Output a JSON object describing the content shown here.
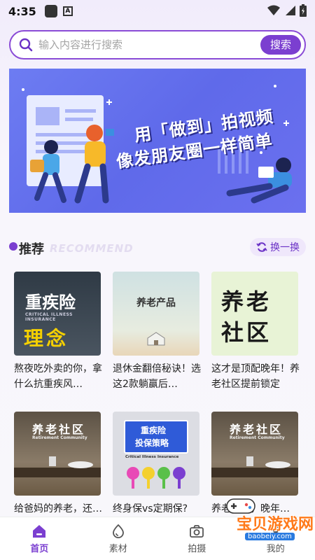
{
  "status_bar": {
    "time": "4:35",
    "icons": [
      "app-square-icon",
      "a-badge-icon",
      "wifi-icon",
      "signal-icon",
      "battery-icon"
    ]
  },
  "search": {
    "placeholder": "输入内容进行搜索",
    "value": "",
    "button_label": "搜索"
  },
  "banner": {
    "line1": "用「做到」拍视频",
    "line2": "像发朋友圈一样简单"
  },
  "recommend": {
    "title": "推荐",
    "title_en": "RECOMMEND",
    "swap_label": "换一换"
  },
  "cards": [
    {
      "caption": "熬夜吃外卖的你，拿什么抗重疾风…",
      "thumb_line1": "重疾险",
      "thumb_line2": "理念",
      "thumb_sub": "CRITICAL ILLNESS INSURANCE"
    },
    {
      "caption": "退休金翻倍秘诀！选这2款躺赢后…",
      "thumb_line1": "养老产品"
    },
    {
      "caption": "这才是顶配晚年！养老社区提前锁定",
      "thumb_line1": "养老",
      "thumb_line2": "社区"
    },
    {
      "caption": "给爸妈的养老，还…",
      "thumb_line1": "养老社区",
      "thumb_sub": "Retirement Community"
    },
    {
      "caption": "终身保vs定期保?",
      "thumb_line1": "重疾险",
      "thumb_line2": "投保策略",
      "thumb_sub": "Critical Illness Insurance"
    },
    {
      "caption": "养老社区，晚年…",
      "thumb_line1": "养老社区",
      "thumb_sub": "Retirement Community"
    }
  ],
  "nav": [
    {
      "label": "首页",
      "icon": "home-icon"
    },
    {
      "label": "素材",
      "icon": "material-icon"
    },
    {
      "label": "拍摄",
      "icon": "camera-icon"
    },
    {
      "label": "我的",
      "icon": "profile-icon"
    }
  ],
  "watermark": {
    "text": "宝贝游戏网",
    "url": "baobeiy.com"
  },
  "colors": {
    "accent": "#7b3fd0",
    "banner": "#6d7cf2"
  }
}
